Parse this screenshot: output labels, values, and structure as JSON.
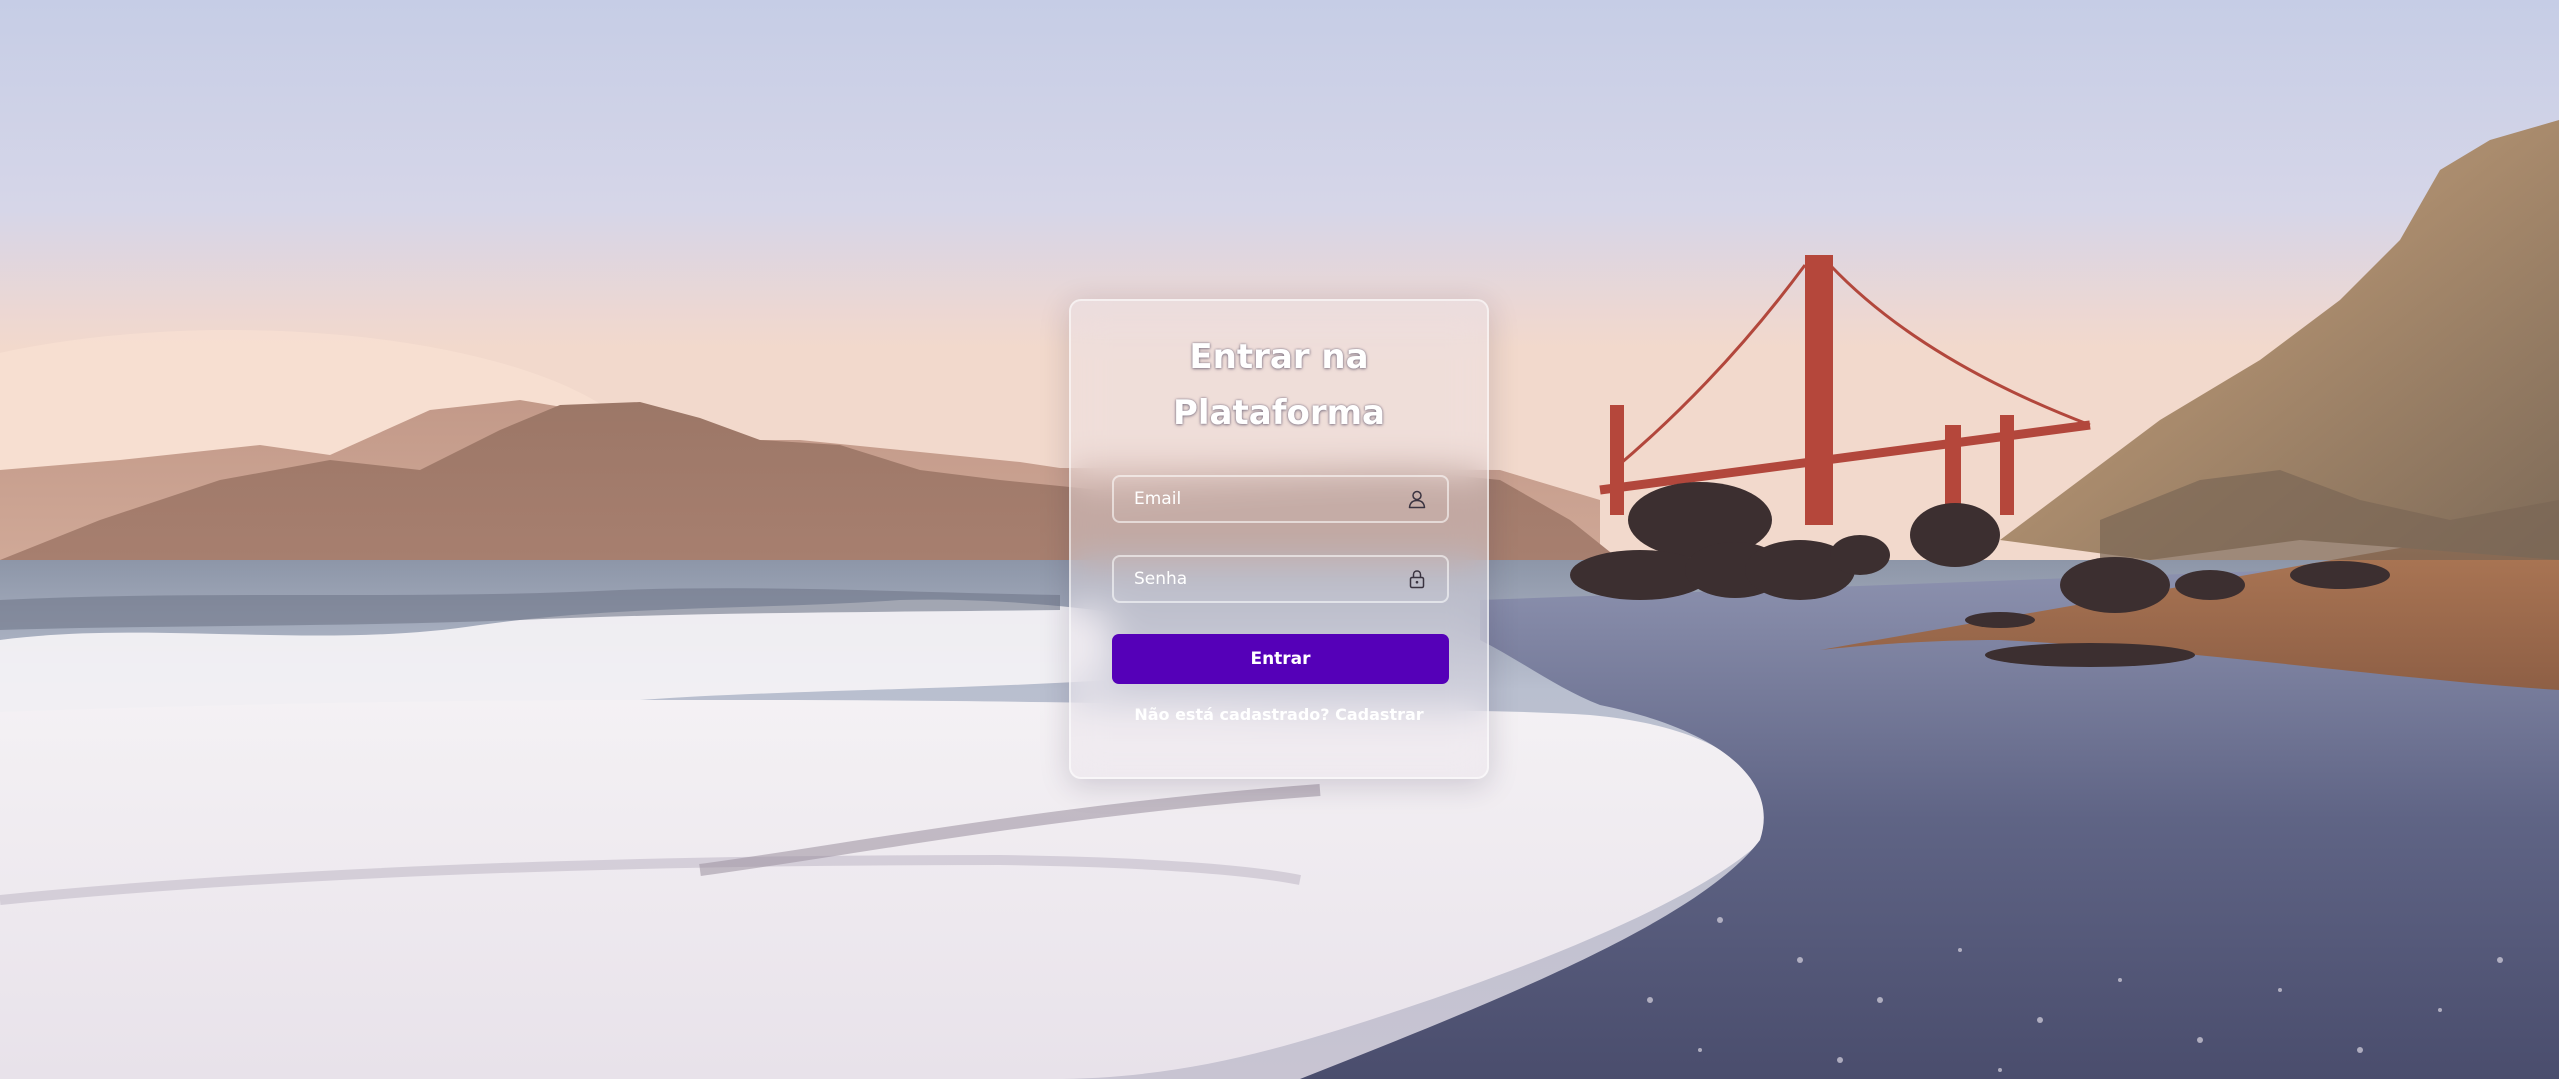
{
  "login": {
    "title_line1": "Entrar na",
    "title_line2": "Plataforma",
    "email": {
      "placeholder": "Email",
      "value": "",
      "icon": "user-icon"
    },
    "password": {
      "placeholder": "Senha",
      "value": "",
      "icon": "lock-icon"
    },
    "submit_label": "Entrar",
    "register_prompt": "Não está cadastrado?",
    "register_link": "Cadastrar"
  },
  "colors": {
    "button": "#5500b8",
    "text": "#ffffff"
  }
}
